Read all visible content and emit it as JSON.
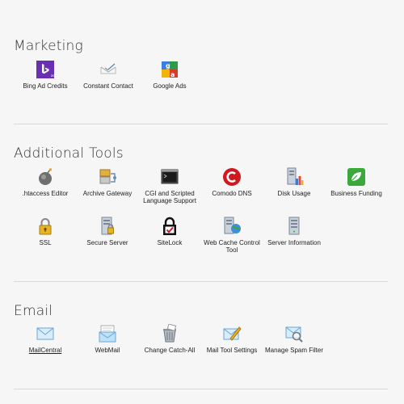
{
  "sections": {
    "marketing": {
      "title": "Marketing",
      "tools": [
        {
          "label": "Bing Ad Credits",
          "icon": "bing-icon"
        },
        {
          "label": "Constant Contact",
          "icon": "envelope-check-icon"
        },
        {
          "label": "Google Ads",
          "icon": "google-ads-icon"
        }
      ]
    },
    "additional": {
      "title": "Additional Tools",
      "tools": [
        {
          "label": ".htaccess Editor",
          "icon": "bomb-icon"
        },
        {
          "label": "Archive Gateway",
          "icon": "archive-gateway-icon"
        },
        {
          "label": "CGI and Scripted Language Support",
          "icon": "terminal-icon"
        },
        {
          "label": "Comodo DNS",
          "icon": "comodo-icon"
        },
        {
          "label": "Disk Usage",
          "icon": "disk-usage-icon"
        },
        {
          "label": "Business Funding",
          "icon": "business-funding-icon"
        },
        {
          "label": "SSL",
          "icon": "padlock-icon"
        },
        {
          "label": "Secure Server",
          "icon": "secure-server-icon"
        },
        {
          "label": "SiteLock",
          "icon": "sitelock-icon"
        },
        {
          "label": "Web Cache Control Tool",
          "icon": "web-cache-icon"
        },
        {
          "label": "Server Information",
          "icon": "server-info-icon"
        }
      ]
    },
    "email": {
      "title": "Email",
      "tools": [
        {
          "label": "MailCentral",
          "icon": "mail-icon"
        },
        {
          "label": "WebMail",
          "icon": "webmail-icon"
        },
        {
          "label": "Change Catch-All",
          "icon": "trash-can-icon"
        },
        {
          "label": "Mail Tool Settings",
          "icon": "mail-pencil-icon"
        },
        {
          "label": "Manage Spam Filter",
          "icon": "spam-filter-icon"
        }
      ]
    }
  },
  "colors": {
    "bing_purple": "#6b2fb3",
    "comodo_red": "#d0181f",
    "funding_green": "#3aa83a",
    "mail_blue": "#7fb8e0"
  }
}
